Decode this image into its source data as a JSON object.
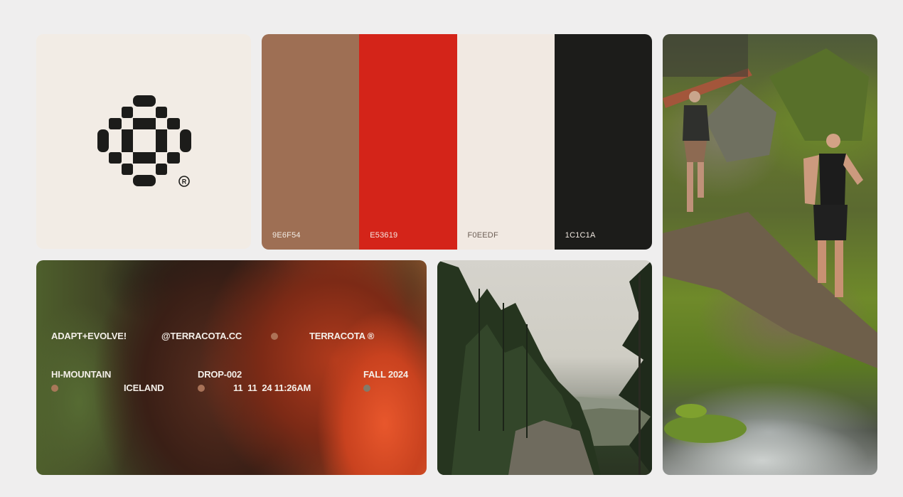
{
  "palette": [
    {
      "code": "9E6F54",
      "hex": "#9e6f54",
      "text_color": "#f2ece5"
    },
    {
      "code": "E53619",
      "hex": "#d42419",
      "text_color": "#f6e6e0"
    },
    {
      "code": "F0EEDF",
      "hex": "#f1e9e2",
      "text_color": "#6b5d54"
    },
    {
      "code": "1C1C1A",
      "hex": "#1c1c1a",
      "text_color": "#f1e9e2"
    }
  ],
  "logo": {
    "mark_color": "#1c1c1a",
    "registered": "®"
  },
  "portrait": {
    "row1": [
      "ADAPT+EVOLVE!",
      "@TERRACOTA.CC",
      "TERRACOTA ®"
    ],
    "row2": [
      "HI-MOUNTAIN",
      "DROP-002",
      "FALL 2024"
    ],
    "row3": [
      "ICELAND",
      "11  11  24 11:26AM"
    ]
  }
}
